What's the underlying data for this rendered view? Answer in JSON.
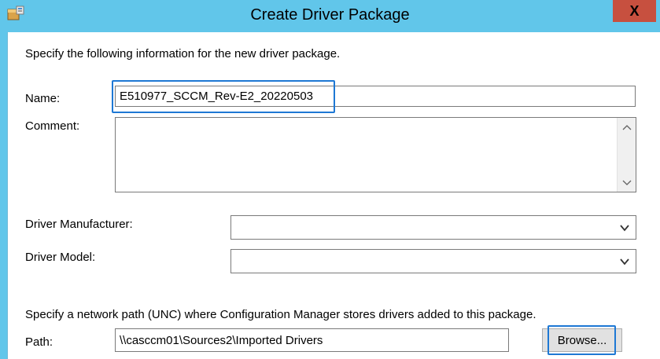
{
  "window": {
    "title": "Create Driver Package",
    "close_label": "X",
    "app_icon": "driver-package-icon"
  },
  "form": {
    "intro": "Specify the following information for the new driver package.",
    "name_label": "Name:",
    "name_value": "E510977_SCCM_Rev-E2_20220503",
    "comment_label": "Comment:",
    "comment_value": "",
    "manufacturer_label": "Driver Manufacturer:",
    "manufacturer_value": "",
    "model_label": "Driver Model:",
    "model_value": "",
    "path_intro": "Specify a network path (UNC) where Configuration Manager stores drivers added to this package.",
    "path_label": "Path:",
    "path_value": "\\\\casccm01\\Sources2\\Imported Drivers",
    "browse_label": "Browse..."
  },
  "colors": {
    "titlebar": "#61c6ea",
    "close_button": "#c7503f",
    "focus_ring": "#1e78d4"
  }
}
